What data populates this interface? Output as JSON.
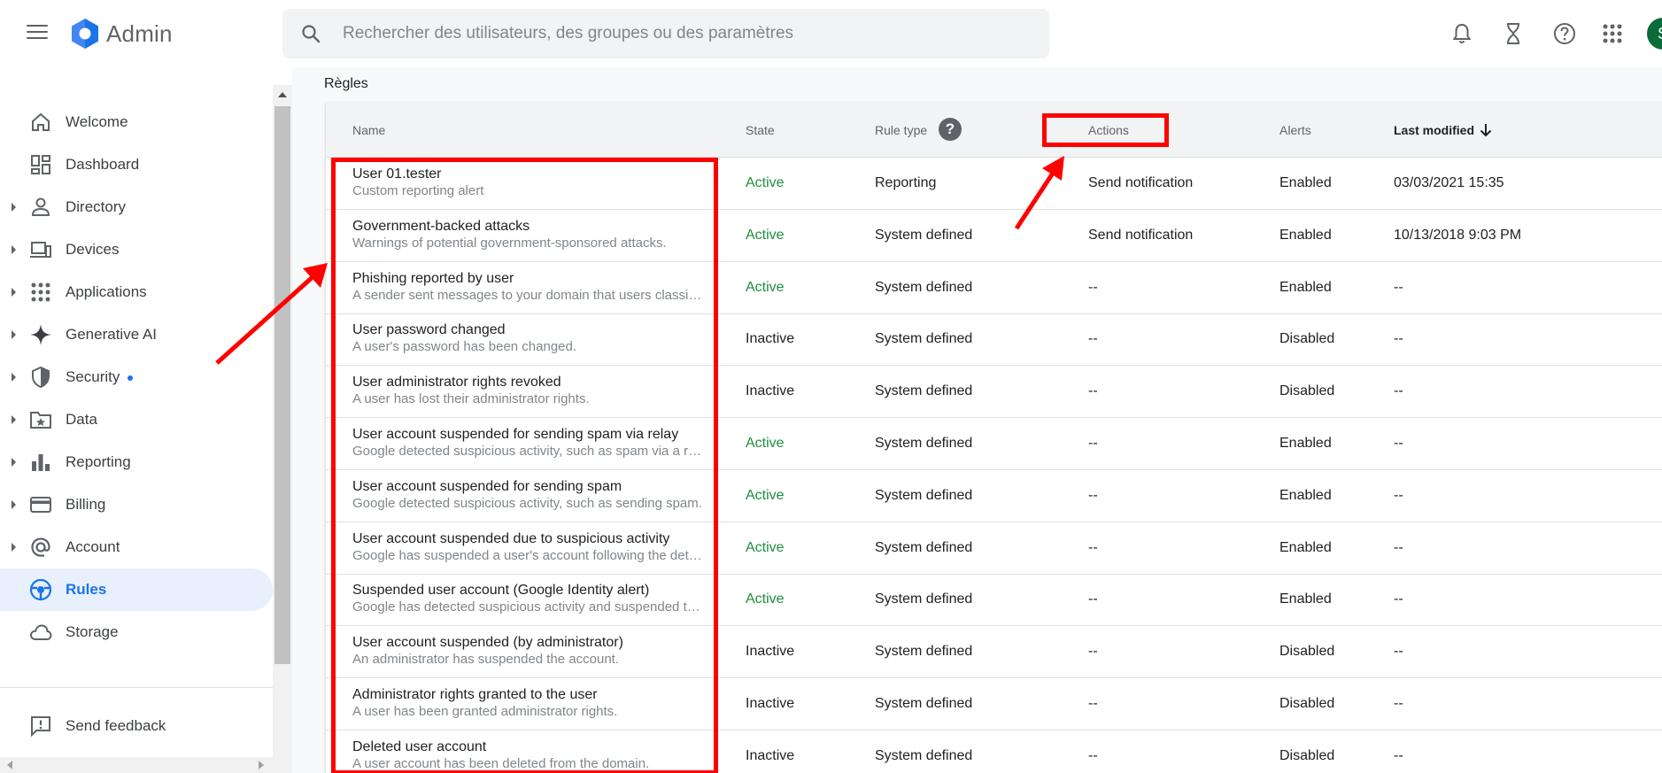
{
  "header": {
    "app_name": "Admin",
    "search_placeholder": "Rechercher des utilisateurs, des groupes ou des paramètres",
    "icons": [
      "bell-icon",
      "hourglass-icon",
      "help-icon",
      "apps-grid-icon"
    ],
    "avatar_initial": "S"
  },
  "sidebar": {
    "items": [
      {
        "label": "Welcome",
        "icon": "home-icon",
        "expandable": false,
        "active": false
      },
      {
        "label": "Dashboard",
        "icon": "dashboard-icon",
        "expandable": false,
        "active": false
      },
      {
        "label": "Directory",
        "icon": "person-icon",
        "expandable": true,
        "active": false
      },
      {
        "label": "Devices",
        "icon": "devices-icon",
        "expandable": true,
        "active": false
      },
      {
        "label": "Applications",
        "icon": "apps-icon",
        "expandable": true,
        "active": false
      },
      {
        "label": "Generative AI",
        "icon": "sparkle-icon",
        "expandable": true,
        "active": false
      },
      {
        "label": "Security",
        "icon": "shield-icon",
        "expandable": true,
        "active": false
      },
      {
        "label": "Data",
        "icon": "folder-star-icon",
        "expandable": true,
        "active": false
      },
      {
        "label": "Reporting",
        "icon": "bar-chart-icon",
        "expandable": true,
        "active": false
      },
      {
        "label": "Billing",
        "icon": "credit-card-icon",
        "expandable": true,
        "active": false
      },
      {
        "label": "Account",
        "icon": "at-sign-icon",
        "expandable": true,
        "active": false
      },
      {
        "label": "Rules",
        "icon": "rules-icon",
        "expandable": false,
        "active": true
      },
      {
        "label": "Storage",
        "icon": "cloud-icon",
        "expandable": false,
        "active": false
      }
    ],
    "feedback_label": "Send feedback"
  },
  "page": {
    "title": "Règles"
  },
  "table": {
    "columns": {
      "name": "Name",
      "state": "State",
      "rule_type": "Rule type",
      "actions": "Actions",
      "alerts": "Alerts",
      "last_modified": "Last modified"
    },
    "rows": [
      {
        "name": "User 01.tester",
        "desc": "Custom reporting alert",
        "state": "Active",
        "rule_type": "Reporting",
        "actions": "Send notification",
        "alerts": "Enabled",
        "last_modified": "03/03/2021 15:35"
      },
      {
        "name": "Government-backed attacks",
        "desc": "Warnings of potential government-sponsored attacks.",
        "state": "Active",
        "rule_type": "System defined",
        "actions": "Send notification",
        "alerts": "Enabled",
        "last_modified": "10/13/2018 9:03 PM"
      },
      {
        "name": "Phishing reported by user",
        "desc": "A sender sent messages to your domain that users classified as phishing.",
        "state": "Active",
        "rule_type": "System defined",
        "actions": "--",
        "alerts": "Enabled",
        "last_modified": "--"
      },
      {
        "name": "User password changed",
        "desc": "A user's password has been changed.",
        "state": "Inactive",
        "rule_type": "System defined",
        "actions": "--",
        "alerts": "Disabled",
        "last_modified": "--"
      },
      {
        "name": "User administrator rights revoked",
        "desc": "A user has lost their administrator rights.",
        "state": "Inactive",
        "rule_type": "System defined",
        "actions": "--",
        "alerts": "Disabled",
        "last_modified": "--"
      },
      {
        "name": "User account suspended for sending spam via relay",
        "desc": "Google detected suspicious activity, such as spam via a relay.",
        "state": "Active",
        "rule_type": "System defined",
        "actions": "--",
        "alerts": "Enabled",
        "last_modified": "--"
      },
      {
        "name": "User account suspended for sending spam",
        "desc": "Google detected suspicious activity, such as sending spam.",
        "state": "Active",
        "rule_type": "System defined",
        "actions": "--",
        "alerts": "Enabled",
        "last_modified": "--"
      },
      {
        "name": "User account suspended due to suspicious activity",
        "desc": "Google has suspended a user's account following the detection of suspicious activity.",
        "state": "Active",
        "rule_type": "System defined",
        "actions": "--",
        "alerts": "Enabled",
        "last_modified": "--"
      },
      {
        "name": "Suspended user account (Google Identity alert)",
        "desc": "Google has detected suspicious activity and suspended the account.",
        "state": "Active",
        "rule_type": "System defined",
        "actions": "--",
        "alerts": "Enabled",
        "last_modified": "--"
      },
      {
        "name": "User account suspended (by administrator)",
        "desc": "An administrator has suspended the account.",
        "state": "Inactive",
        "rule_type": "System defined",
        "actions": "--",
        "alerts": "Disabled",
        "last_modified": "--"
      },
      {
        "name": "Administrator rights granted to the user",
        "desc": "A user has been granted administrator rights.",
        "state": "Inactive",
        "rule_type": "System defined",
        "actions": "--",
        "alerts": "Disabled",
        "last_modified": "--"
      },
      {
        "name": "Deleted user account",
        "desc": "A user account has been deleted from the domain.",
        "state": "Inactive",
        "rule_type": "System defined",
        "actions": "--",
        "alerts": "Disabled",
        "last_modified": "--"
      }
    ]
  },
  "colors": {
    "accent": "#1a73e8",
    "active_state": "#1e8e3e",
    "annotation": "#ff0000",
    "active_nav_bg": "#e8f0fe"
  }
}
